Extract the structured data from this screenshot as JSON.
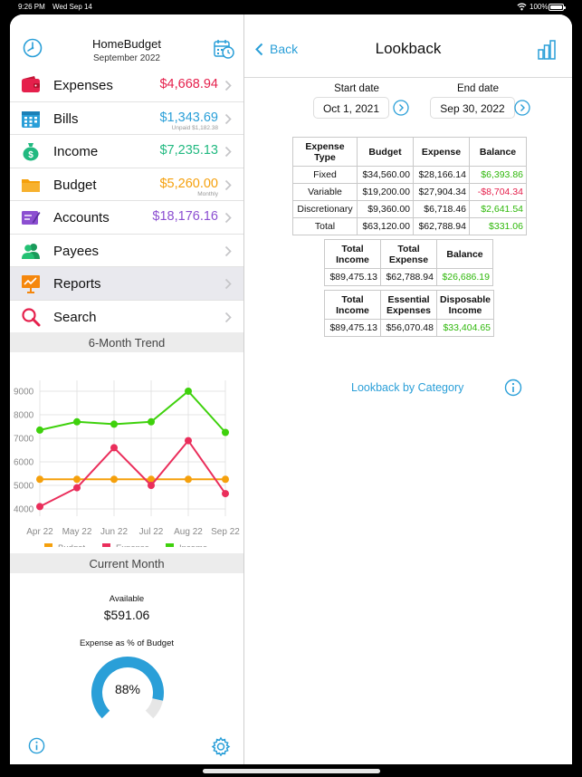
{
  "status_bar": {
    "time": "9:26 PM",
    "date": "Wed Sep 14",
    "battery": "100%"
  },
  "sidebar": {
    "title": "HomeBudget",
    "subtitle": "September 2022",
    "items": [
      {
        "label": "Expenses",
        "amount": "$4,668.94",
        "note": "",
        "color": "#e5204c"
      },
      {
        "label": "Bills",
        "amount": "$1,343.69",
        "note": "Unpaid $1,182.38",
        "color": "#2a9fd8"
      },
      {
        "label": "Income",
        "amount": "$7,235.13",
        "note": "",
        "color": "#21b980"
      },
      {
        "label": "Budget",
        "amount": "$5,260.00",
        "note": "Monthly",
        "color": "#f5a00c"
      },
      {
        "label": "Accounts",
        "amount": "$18,176.16",
        "note": "",
        "color": "#8c4fd1"
      },
      {
        "label": "Payees",
        "amount": "",
        "note": "",
        "color": "#111111"
      },
      {
        "label": "Reports",
        "amount": "",
        "note": "",
        "color": "#111111"
      },
      {
        "label": "Search",
        "amount": "",
        "note": "",
        "color": "#111111"
      }
    ],
    "trend_header": "6-Month Trend",
    "current_month_header": "Current Month",
    "available_label": "Available",
    "available_value": "$591.06",
    "expense_pct_label": "Expense as % of Budget",
    "expense_pct_value": "88%"
  },
  "chart_data": {
    "type": "line",
    "categories": [
      "Apr 22",
      "May 22",
      "Jun 22",
      "Jul 22",
      "Aug 22",
      "Sep 22"
    ],
    "series": [
      {
        "name": "Budget",
        "color": "#f5a00c",
        "values": [
          5260,
          5260,
          5260,
          5260,
          5260,
          5260
        ]
      },
      {
        "name": "Expense",
        "color": "#ea2e5b",
        "values": [
          4100,
          4900,
          6600,
          5000,
          6900,
          4650
        ]
      },
      {
        "name": "Income",
        "color": "#3ed10c",
        "values": [
          7350,
          7700,
          7600,
          7700,
          9000,
          7250
        ]
      }
    ],
    "yticks": [
      "9000",
      "8000",
      "7000",
      "6000",
      "5000",
      "4000"
    ],
    "ylim": [
      4000,
      9000
    ],
    "legend_position": "bottom"
  },
  "lookback": {
    "back_label": "Back",
    "title": "Lookback",
    "start_label": "Start date",
    "start_value": "Oct 1, 2021",
    "end_label": "End date",
    "end_value": "Sep 30, 2022",
    "table1": {
      "headers": [
        "Expense Type",
        "Budget",
        "Expense",
        "Balance"
      ],
      "rows": [
        [
          "Fixed",
          "$34,560.00",
          "$28,166.14",
          "$6,393.86"
        ],
        [
          "Variable",
          "$19,200.00",
          "$27,904.34",
          "-$8,704.34"
        ],
        [
          "Discretionary",
          "$9,360.00",
          "$6,718.46",
          "$2,641.54"
        ],
        [
          "Total",
          "$63,120.00",
          "$62,788.94",
          "$331.06"
        ]
      ]
    },
    "table2": {
      "headers": [
        "Total Income",
        "Total Expense",
        "Balance"
      ],
      "row": [
        "$89,475.13",
        "$62,788.94",
        "$26,686.19"
      ]
    },
    "table3": {
      "headers": [
        "Total Income",
        "Essential Expenses",
        "Disposable Income"
      ],
      "row": [
        "$89,475.13",
        "$56,070.48",
        "$33,404.65"
      ]
    },
    "category_link": "Lookback by Category"
  }
}
